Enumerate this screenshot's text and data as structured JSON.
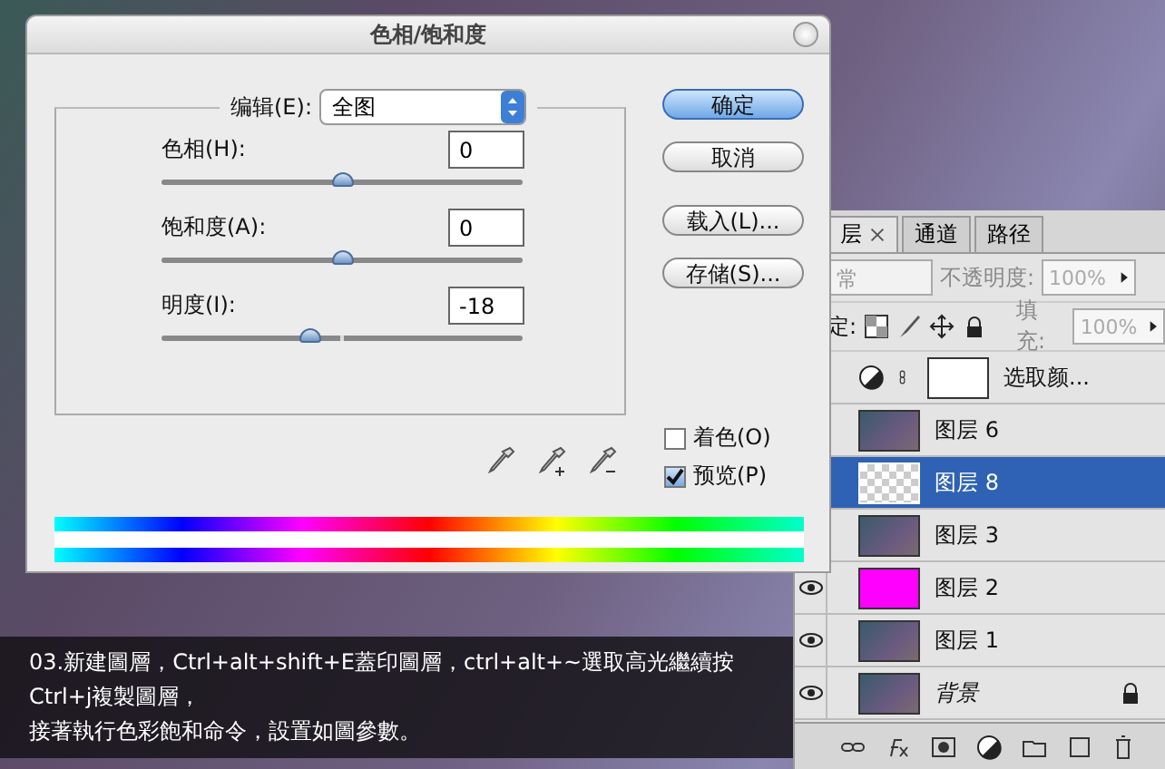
{
  "dialog": {
    "title": "色相/饱和度",
    "edit": {
      "label": "编辑(E):",
      "value": "全图"
    },
    "params": [
      {
        "label": "色相(H):",
        "value": "0",
        "level": 0.5
      },
      {
        "label": "饱和度(A):",
        "value": "0",
        "level": 0.5
      },
      {
        "label": "明度(I):",
        "value": "-18",
        "level": 0.41
      }
    ],
    "buttons": [
      {
        "label": "确定",
        "default": true
      },
      {
        "label": "取消",
        "default": false
      },
      {
        "label": "载入(L)...",
        "default": false
      },
      {
        "label": "存储(S)...",
        "default": false
      }
    ],
    "checkboxes": [
      {
        "label": "着色(O)",
        "checked": false
      },
      {
        "label": "预览(P)",
        "checked": true
      }
    ]
  },
  "layers_panel": {
    "tabs": [
      {
        "label": "层",
        "selected": true
      },
      {
        "label": "通道",
        "selected": false
      },
      {
        "label": "路径",
        "selected": false
      }
    ],
    "blend_mode": "常",
    "opacity_label": "不透明度:",
    "opacity": "100%",
    "lock_label": "定:",
    "fill_label": "填充:",
    "fill": "100%",
    "layers": [
      {
        "name": "选取颜...",
        "kind": "adjustment",
        "selected": false,
        "locked": false
      },
      {
        "name": "图层 6",
        "kind": "photo",
        "selected": false,
        "locked": false
      },
      {
        "name": "图层 8",
        "kind": "transparent",
        "selected": true,
        "locked": false
      },
      {
        "name": "图层 3",
        "kind": "photo",
        "selected": false,
        "locked": false
      },
      {
        "name": "图层 2",
        "kind": "fill",
        "color": "#ff00ff",
        "selected": false,
        "locked": false
      },
      {
        "name": "图层 1",
        "kind": "photo",
        "selected": false,
        "locked": false
      },
      {
        "name": "背景",
        "kind": "photo",
        "selected": false,
        "locked": true
      }
    ]
  },
  "caption": {
    "lines": [
      "03.新建圖層，Ctrl+alt+shift+E蓋印圖層，ctrl+alt+~選取高光繼續按Ctrl+j複製圖層，",
      "接著執行色彩飽和命令，設置如圖參數。"
    ]
  }
}
